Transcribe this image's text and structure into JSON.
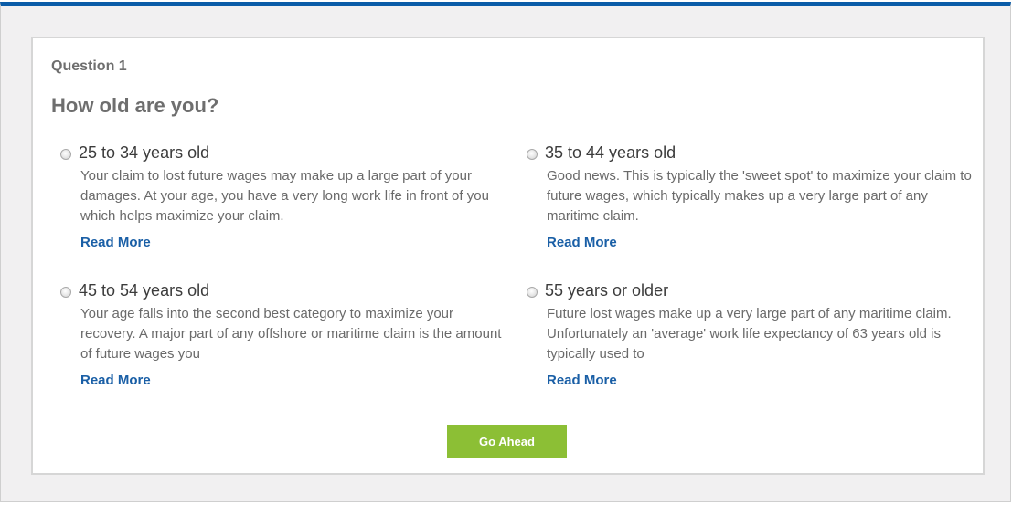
{
  "question": {
    "number_label": "Question 1",
    "title": "How old are you?"
  },
  "options": [
    {
      "label": "25 to 34 years old",
      "description": "Your claim to lost future wages may make up a large part of your damages. At your age, you have a very long work life in front of you which helps maximize your claim.",
      "read_more": "Read More",
      "selected": false
    },
    {
      "label": "35 to 44 years old",
      "description": "Good news. This is typically the 'sweet spot' to maximize your claim to future wages, which typically makes up a very large part of any maritime claim.",
      "read_more": "Read More",
      "selected": false
    },
    {
      "label": "45 to 54 years old",
      "description": "Your age falls into the second best category to maximize your recovery. A major part of any offshore or maritime claim is the amount of future wages you",
      "read_more": "Read More",
      "selected": false
    },
    {
      "label": "55 years or older",
      "description": "Future lost wages make up a very large part of any maritime claim. Unfortunately an 'average' work life expectancy of 63 years old is typically used to",
      "read_more": "Read More",
      "selected": false
    }
  ],
  "actions": {
    "go_ahead_label": "Go Ahead"
  },
  "colors": {
    "top_bar": "#0a5ca8",
    "link": "#1a5fa6",
    "button": "#8cbf35"
  }
}
